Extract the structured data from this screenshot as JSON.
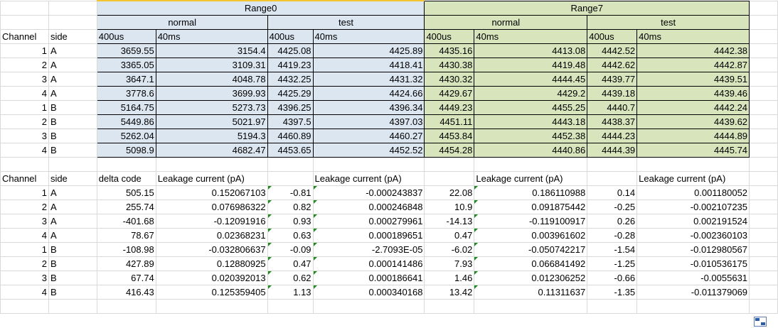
{
  "top_table": {
    "range0_label": "Range0",
    "range7_label": "Range7",
    "normal_label": "normal",
    "test_label": "test",
    "col_400us": "400us",
    "col_40ms": "40ms",
    "channel_header": "Channel",
    "side_header": "side",
    "rows": [
      {
        "channel": "1",
        "side": "A",
        "r0n400": "3659.55",
        "r0n40": "3154.4",
        "r0t400": "4425.08",
        "r0t40": "4425.89",
        "r7n400": "4435.16",
        "r7n40": "4413.08",
        "r7t400": "4442.52",
        "r7t40": "4442.38"
      },
      {
        "channel": "2",
        "side": "A",
        "r0n400": "3365.05",
        "r0n40": "3109.31",
        "r0t400": "4419.23",
        "r0t40": "4418.41",
        "r7n400": "4430.38",
        "r7n40": "4419.48",
        "r7t400": "4442.62",
        "r7t40": "4442.87"
      },
      {
        "channel": "3",
        "side": "A",
        "r0n400": "3647.1",
        "r0n40": "4048.78",
        "r0t400": "4432.25",
        "r0t40": "4431.32",
        "r7n400": "4430.32",
        "r7n40": "4444.45",
        "r7t400": "4439.77",
        "r7t40": "4439.51"
      },
      {
        "channel": "4",
        "side": "A",
        "r0n400": "3778.6",
        "r0n40": "3699.93",
        "r0t400": "4425.29",
        "r0t40": "4424.66",
        "r7n400": "4429.67",
        "r7n40": "4429.2",
        "r7t400": "4439.18",
        "r7t40": "4439.46"
      },
      {
        "channel": "1",
        "side": "B",
        "r0n400": "5164.75",
        "r0n40": "5273.73",
        "r0t400": "4396.25",
        "r0t40": "4396.34",
        "r7n400": "4449.23",
        "r7n40": "4455.25",
        "r7t400": "4440.7",
        "r7t40": "4442.24"
      },
      {
        "channel": "2",
        "side": "B",
        "r0n400": "5449.86",
        "r0n40": "5021.97",
        "r0t400": "4397.5",
        "r0t40": "4397.03",
        "r7n400": "4451.11",
        "r7n40": "4443.18",
        "r7t400": "4438.37",
        "r7t40": "4439.62"
      },
      {
        "channel": "3",
        "side": "B",
        "r0n400": "5262.04",
        "r0n40": "5194.3",
        "r0t400": "4460.89",
        "r0t40": "4460.27",
        "r7n400": "4453.84",
        "r7n40": "4452.38",
        "r7t400": "4444.23",
        "r7t40": "4444.89"
      },
      {
        "channel": "4",
        "side": "B",
        "r0n400": "5098.9",
        "r0n40": "4682.47",
        "r0t400": "4453.65",
        "r0t40": "4452.52",
        "r7n400": "4454.28",
        "r7n40": "4440.86",
        "r7t400": "4444.39",
        "r7t40": "4445.74"
      }
    ]
  },
  "bottom_table": {
    "channel_header": "Channel",
    "side_header": "side",
    "delta_header": "delta code",
    "leak_header": "Leakage current (pA)",
    "rows": [
      {
        "channel": "1",
        "side": "A",
        "d1": "505.15",
        "l1": "0.152067103",
        "d2": "-0.81",
        "l2": "-0.000243837",
        "d3": "22.08",
        "l3": "0.186110988",
        "d4": "0.14",
        "l4": "0.001180052"
      },
      {
        "channel": "2",
        "side": "A",
        "d1": "255.74",
        "l1": "0.076986322",
        "d2": "0.82",
        "l2": "0.000246848",
        "d3": "10.9",
        "l3": "0.091875442",
        "d4": "-0.25",
        "l4": "-0.002107235"
      },
      {
        "channel": "3",
        "side": "A",
        "d1": "-401.68",
        "l1": "-0.12091916",
        "d2": "0.93",
        "l2": "0.000279961",
        "d3": "-14.13",
        "l3": "-0.119100917",
        "d4": "0.26",
        "l4": "0.002191524"
      },
      {
        "channel": "4",
        "side": "A",
        "d1": "78.67",
        "l1": "0.02368231",
        "d2": "0.63",
        "l2": "0.000189651",
        "d3": "0.47",
        "l3": "0.003961602",
        "d4": "-0.28",
        "l4": "-0.002360103"
      },
      {
        "channel": "1",
        "side": "B",
        "d1": "-108.98",
        "l1": "-0.032806637",
        "d2": "-0.09",
        "l2": "-2.7093E-05",
        "d3": "-6.02",
        "l3": "-0.050742217",
        "d4": "-1.54",
        "l4": "-0.012980567"
      },
      {
        "channel": "2",
        "side": "B",
        "d1": "427.89",
        "l1": "0.12880925",
        "d2": "0.47",
        "l2": "0.000141486",
        "d3": "7.93",
        "l3": "0.066841492",
        "d4": "-1.25",
        "l4": "-0.010536175"
      },
      {
        "channel": "3",
        "side": "B",
        "d1": "67.74",
        "l1": "0.020392013",
        "d2": "0.62",
        "l2": "0.000186641",
        "d3": "1.46",
        "l3": "0.012306252",
        "d4": "-0.66",
        "l4": "-0.0055631"
      },
      {
        "channel": "4",
        "side": "B",
        "d1": "416.43",
        "l1": "0.125359405",
        "d2": "1.13",
        "l2": "0.000340168",
        "d3": "13.42",
        "l3": "0.11311637",
        "d4": "-1.35",
        "l4": "-0.011379069"
      }
    ]
  },
  "icons": {
    "paste_options": "paste-options-icon"
  },
  "colors": {
    "range0_fill": "#dce6f1",
    "range7_fill": "#d8e4bc",
    "error_marker": "#1f8a1f"
  }
}
